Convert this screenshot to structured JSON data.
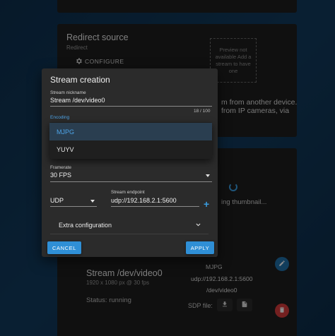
{
  "redirect_card": {
    "title": "Redirect source",
    "subtitle": "Redirect",
    "configure_label": "CONFIGURE",
    "thumbnail_text": "Preview not available Add a stream to have one",
    "description_line1": "m from another device.",
    "description_line2": "from IP cameras, via"
  },
  "stream_card": {
    "thumbnail_status": "ing thumbnail...",
    "name": "Stream /dev/video0",
    "resolution": "1920 x 1080 px @ 30 fps",
    "status": "Status: running",
    "encoding": "MJPG",
    "endpoint": "udp://192.168.2.1:5600",
    "device": "/dev/video0",
    "sdp_label": "SDP file:"
  },
  "dialog": {
    "title": "Stream creation",
    "nickname_label": "Stream nickname",
    "nickname_value": "Stream /dev/video0",
    "nickname_counter": "18 / 100",
    "encoding_label": "Encoding",
    "encoding_options": [
      "MJPG",
      "YUYV"
    ],
    "framerate_label": "Framerate",
    "framerate_value": "30 FPS",
    "protocol_value": "UDP",
    "endpoint_label": "Stream endpoint",
    "endpoint_value": "udp://192.168.2.1:5600",
    "extra_config_label": "Extra configuration",
    "cancel_label": "CANCEL",
    "apply_label": "APPLY"
  },
  "colors": {
    "accent": "#2f8fd6",
    "edit_fab": "#1f6fa8",
    "delete_fab": "#d33b3b"
  },
  "icons": [
    "gear-icon",
    "spinner-icon",
    "plus-icon",
    "chevron-down-icon",
    "download-icon",
    "file-icon",
    "pencil-icon",
    "trash-icon"
  ]
}
